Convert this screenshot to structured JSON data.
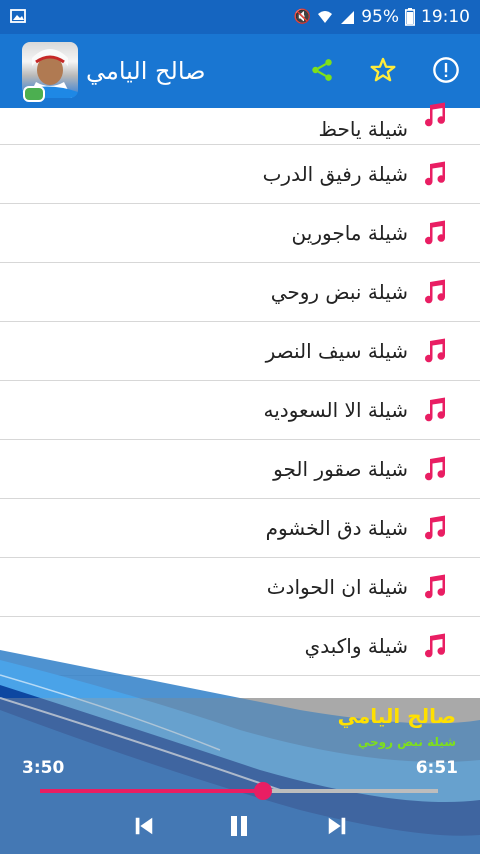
{
  "status_bar": {
    "battery": "95%",
    "time": "19:10"
  },
  "app_bar": {
    "title": "صالح اليامي"
  },
  "list": {
    "items": [
      {
        "label": "شيلة ياحظ"
      },
      {
        "label": "شيلة رفيق الدرب"
      },
      {
        "label": "شيلة ماجورين"
      },
      {
        "label": "شيلة نبض روحي"
      },
      {
        "label": "شيلة سيف النصر"
      },
      {
        "label": "شيلة الا السعوديه"
      },
      {
        "label": "شيلة صقور الجو"
      },
      {
        "label": "شيلة دق الخشوم"
      },
      {
        "label": "شيلة ان الحوادث"
      },
      {
        "label": "شيلة واكبدي"
      }
    ]
  },
  "player": {
    "title": "صالح اليامي",
    "subtitle": "شيلة نبض روحي",
    "current_time": "3:50",
    "total_time": "6:51",
    "progress": 0.56
  },
  "colors": {
    "primary": "#1976d2",
    "status_bar": "#1565c0",
    "accent": "#e91e63",
    "note_icon": "#e91e63",
    "player_title": "#ffe000"
  },
  "icons": {
    "app_bar": [
      "info-icon",
      "star-icon",
      "share-icon"
    ],
    "list": "music-note-icon",
    "player": [
      "previous-icon",
      "pause-icon",
      "next-icon"
    ]
  }
}
